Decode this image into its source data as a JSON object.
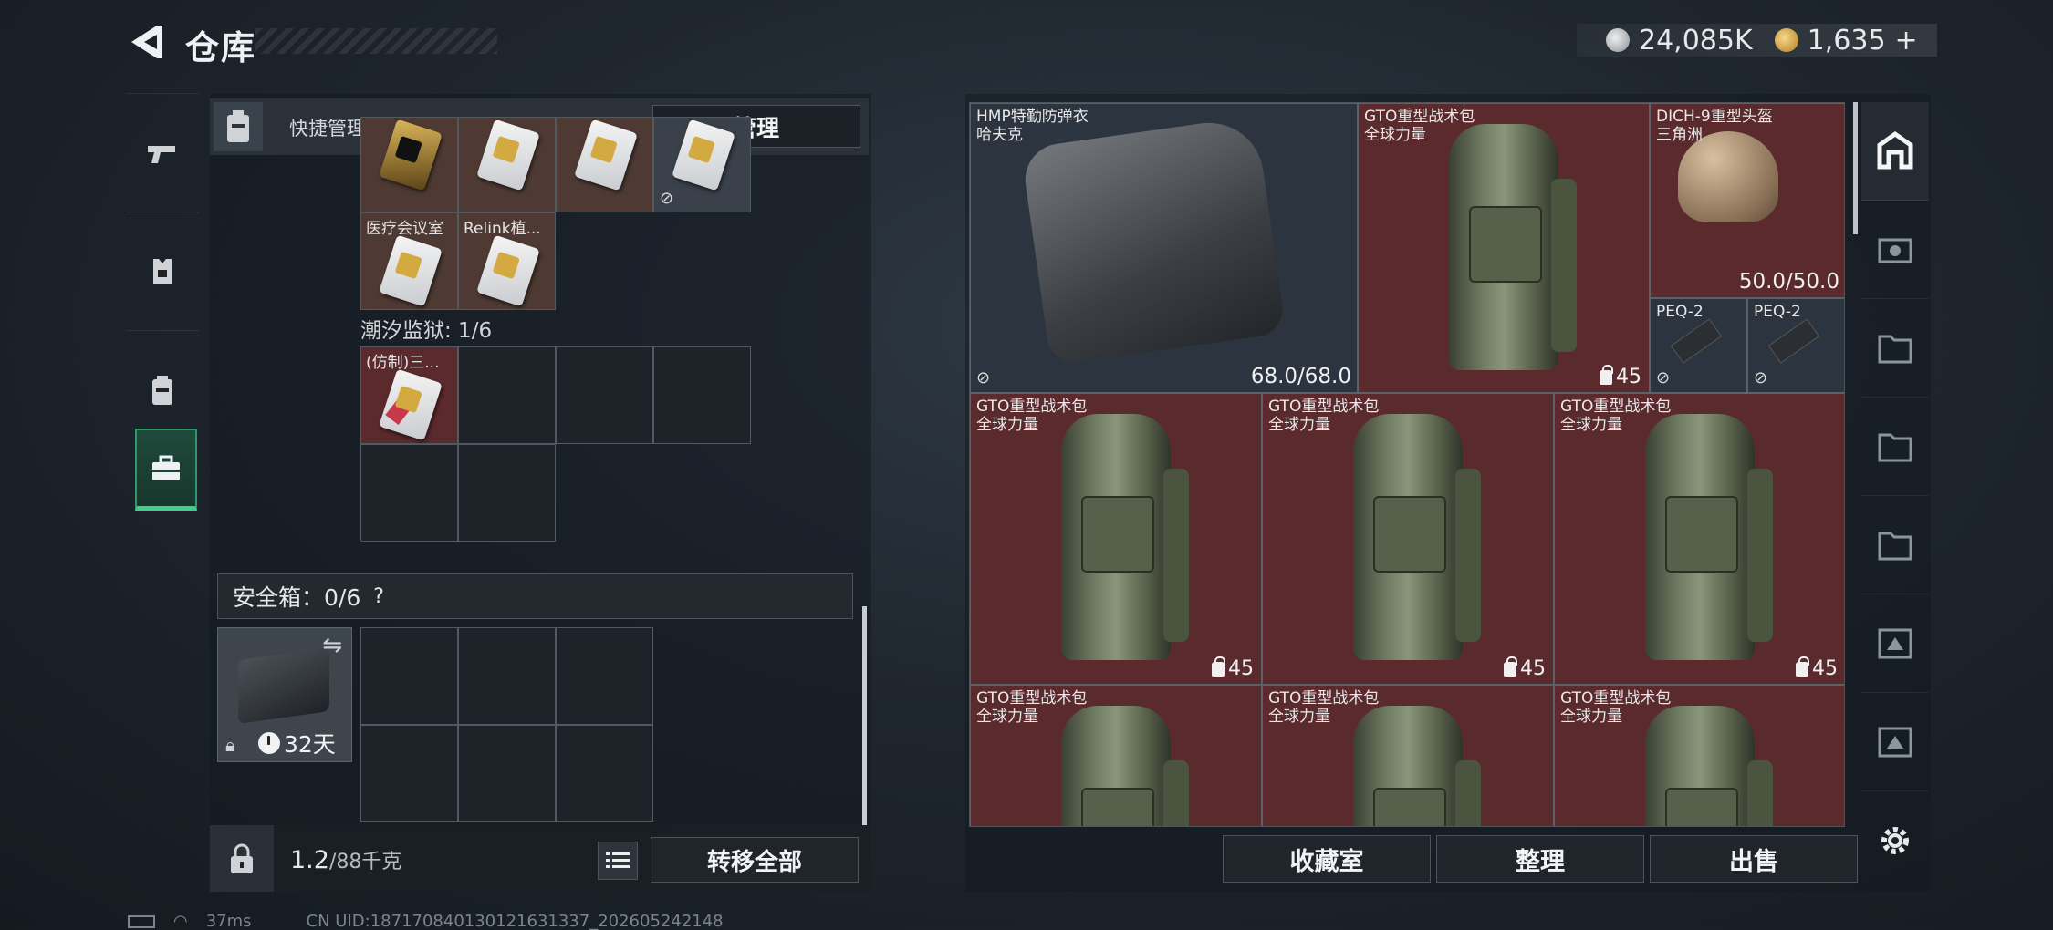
{
  "header": {
    "title": "仓库",
    "back_icon": "back-arrow-icon"
  },
  "currency": {
    "silver": "24,085K",
    "gold": "1,635",
    "plus": "+"
  },
  "left_nav": [
    {
      "icon": "pistol-icon"
    },
    {
      "icon": "armor-vest-icon"
    },
    {
      "icon": "backpack-icon"
    },
    {
      "icon": "toolbox-icon",
      "active": true
    }
  ],
  "keycard_panel": {
    "title": "快捷管理门卡",
    "manage_button": "管理",
    "top_row": [
      {
        "label": "",
        "color": "brown",
        "card": "gold"
      },
      {
        "label": "",
        "color": "brown",
        "card": "silver"
      },
      {
        "label": "",
        "color": "brown",
        "card": "silver"
      },
      {
        "label": "",
        "color": "gray",
        "card": "silver"
      }
    ],
    "second_row": [
      {
        "label": "医疗会议室",
        "color": "brown"
      },
      {
        "label": "Relink植...",
        "color": "brown"
      }
    ],
    "prison_section": "潮汐监狱: 1/6",
    "prison_items": [
      {
        "label": "(仿制)三...",
        "color": "red"
      }
    ]
  },
  "safe": {
    "label": "安全箱：0/6",
    "help": "?",
    "days": "32天"
  },
  "bottom": {
    "weight_current": "1.2",
    "weight_max": "/88千克",
    "transfer_button": "转移全部"
  },
  "stash": {
    "items": [
      {
        "name": "HMP特勤防弹衣",
        "sub": "哈夫克",
        "durability": "68.0/68.0"
      },
      {
        "name": "GTO重型战术包",
        "sub": "全球力量",
        "capacity": "45"
      },
      {
        "name": "DICH-9重型头盔",
        "sub": "三角洲",
        "durability": "50.0/50.0"
      },
      {
        "name": "PEQ-2"
      },
      {
        "name": "PEQ-2"
      },
      {
        "name": "GTO重型战术包",
        "sub": "全球力量",
        "capacity": "45"
      },
      {
        "name": "GTO重型战术包",
        "sub": "全球力量",
        "capacity": "45"
      },
      {
        "name": "GTO重型战术包",
        "sub": "全球力量",
        "capacity": "45"
      },
      {
        "name": "GTO重型战术包",
        "sub": "全球力量"
      },
      {
        "name": "GTO重型战术包",
        "sub": "全球力量"
      },
      {
        "name": "GTO重型战术包",
        "sub": "全球力量"
      }
    ],
    "buttons": {
      "collection": "收藏室",
      "sort": "整理",
      "sell": "出售"
    }
  },
  "right_nav": [
    {
      "icon": "stash-home-icon"
    },
    {
      "icon": "collection-icon"
    },
    {
      "icon": "storage-1-icon"
    },
    {
      "icon": "storage-2-icon"
    },
    {
      "icon": "storage-3-icon"
    },
    {
      "icon": "storage-4-icon"
    },
    {
      "icon": "storage-5-icon"
    },
    {
      "icon": "settings-gear-icon"
    }
  ],
  "status_bar": {
    "ping": "37ms",
    "uid": "CN UID:18717084013012​1631337_202605242148"
  }
}
